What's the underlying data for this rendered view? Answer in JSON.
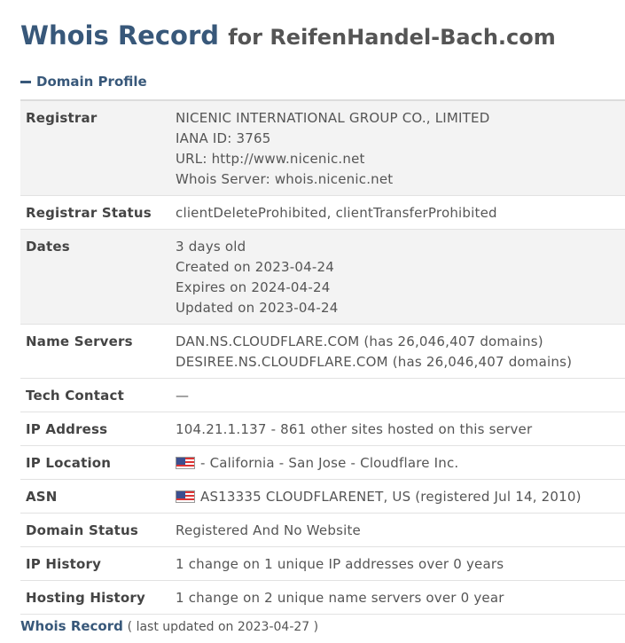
{
  "title": {
    "main": "Whois Record",
    "suffix": "for ReifenHandel-Bach.com"
  },
  "section": {
    "label": "Domain Profile",
    "icon": "minus-icon"
  },
  "rows": [
    {
      "label": "Registrar",
      "lines": [
        "NICENIC INTERNATIONAL GROUP CO., LIMITED",
        "IANA ID: 3765",
        "URL: http://www.nicenic.net",
        "Whois Server: whois.nicenic.net"
      ]
    },
    {
      "label": "Registrar Status",
      "lines": [
        "clientDeleteProhibited, clientTransferProhibited"
      ]
    },
    {
      "label": "Dates",
      "lines": [
        "3 days old",
        "Created on 2023-04-24",
        "Expires on 2024-04-24",
        "Updated on 2023-04-24"
      ]
    },
    {
      "label": "Name Servers",
      "lines": [
        "DAN.NS.CLOUDFLARE.COM (has 26,046,407 domains)",
        "DESIREE.NS.CLOUDFLARE.COM (has 26,046,407 domains)"
      ]
    },
    {
      "label": "Tech Contact",
      "lines": [
        "—"
      ]
    },
    {
      "label": "IP Address",
      "lines": [
        "104.21.1.137 - 861 other sites hosted on this server"
      ]
    },
    {
      "label": "IP Location",
      "lines": [
        "- California - San Jose - Cloudflare Inc."
      ],
      "icon": "us-flag-icon"
    },
    {
      "label": "ASN",
      "lines": [
        "AS13335 CLOUDFLARENET, US (registered Jul 14, 2010)"
      ],
      "icon": "us-flag-icon"
    },
    {
      "label": "Domain Status",
      "lines": [
        "Registered And No Website"
      ]
    },
    {
      "label": "IP History",
      "lines": [
        "1 change on 1 unique IP addresses over 0 years"
      ]
    },
    {
      "label": "Hosting History",
      "lines": [
        "1 change on 2 unique name servers over 0 year"
      ]
    }
  ],
  "footer": {
    "link": "Whois Record",
    "note": "( last updated on 2023-04-27 )"
  },
  "colors": {
    "accent": "#38587a",
    "shade": "#f3f3f3"
  }
}
